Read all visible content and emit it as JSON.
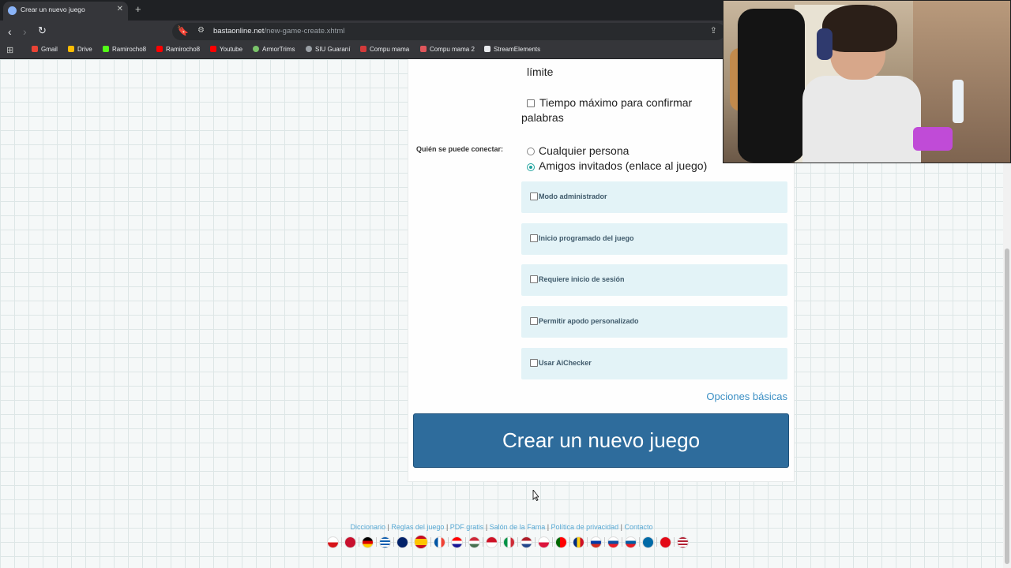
{
  "browser": {
    "tab_title": "Crear un nuevo juego",
    "url_host": "bastaonline.net",
    "url_path": "/new-game-create.xhtml",
    "bookmarks": [
      "Gmail",
      "Drive",
      "Ramirocho8",
      "Ramirocho8",
      "Youtube",
      "ArmorTrims",
      "SIU Guaraní",
      "Compu mama",
      "Compu mama 2",
      "StreamElements"
    ]
  },
  "form": {
    "limit_tail": "límite",
    "max_time_label": "Tiempo máximo para confirmar palabras",
    "who_label": "Quién se puede conectar:",
    "who_options": [
      "Cualquier persona",
      "Amigos invitados (enlace al juego)"
    ],
    "who_selected_index": 1,
    "advanced": [
      "Modo administrador",
      "Inicio programado del juego",
      "Requiere inicio de sesión",
      "Permitir apodo personalizado",
      "Usar AiChecker"
    ],
    "basic_options_link": "Opciones básicas",
    "create_button": "Crear un nuevo juego"
  },
  "footer": {
    "links": [
      "Diccionario",
      "Reglas del juego",
      "PDF gratis",
      "Salón de la Fama",
      "Política de privacidad",
      "Contacto"
    ],
    "flag_count": 21
  },
  "colors": {
    "button_bg": "#2e6c9c",
    "option_box_bg": "#e3f3f7",
    "link": "#3b8fc4"
  }
}
